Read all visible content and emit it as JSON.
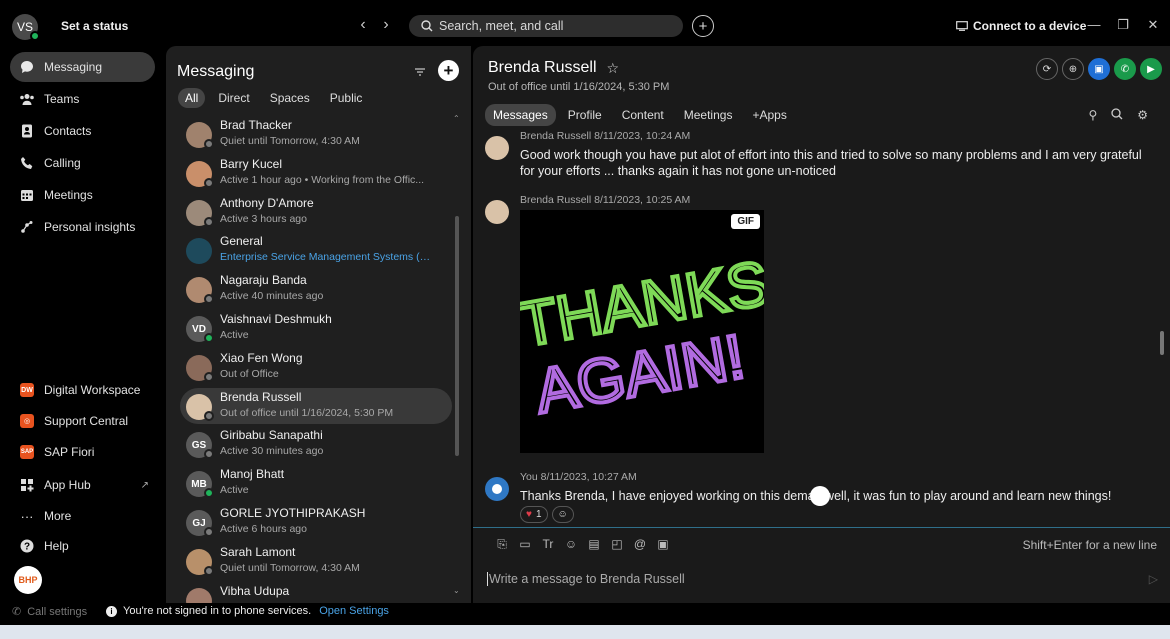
{
  "topbar": {
    "avatar_initials": "VS",
    "set_status": "Set a status",
    "back": "‹",
    "forward": "›",
    "search_placeholder": "Search, meet, and call",
    "connect_device": "Connect to a device",
    "minimize": "—",
    "restore": "❐",
    "close": "✕"
  },
  "nav": {
    "items": [
      {
        "label": "Messaging",
        "icon": "chat-icon"
      },
      {
        "label": "Teams",
        "icon": "teams-icon"
      },
      {
        "label": "Contacts",
        "icon": "contacts-icon"
      },
      {
        "label": "Calling",
        "icon": "phone-icon"
      },
      {
        "label": "Meetings",
        "icon": "calendar-icon"
      },
      {
        "label": "Personal insights",
        "icon": "insights-icon"
      }
    ],
    "apps": [
      {
        "label": "Digital Workspace",
        "badge": "DW",
        "color": "#e8531f"
      },
      {
        "label": "Support Central",
        "badge": "SC",
        "color": "#e8531f"
      },
      {
        "label": "SAP Fiori",
        "badge": "SAP",
        "color": "#e8531f"
      },
      {
        "label": "App Hub",
        "badge": "",
        "color": "#cccccc"
      },
      {
        "label": "More",
        "badge": "",
        "color": "#cccccc"
      },
      {
        "label": "Help",
        "badge": "",
        "color": "#cccccc"
      }
    ],
    "bhp_logo": "BHP"
  },
  "messaging": {
    "title": "Messaging",
    "tabs": [
      "All",
      "Direct",
      "Spaces",
      "Public"
    ],
    "contacts": [
      {
        "name": "Brad Thacker",
        "status": "Quiet until Tomorrow, 4:30 AM",
        "initials": "",
        "avatar_color": "#a0826d",
        "presence": "#7a7a7a",
        "link": false
      },
      {
        "name": "Barry Kucel",
        "status": "Active 1 hour ago • Working from the Offic...",
        "initials": "",
        "avatar_color": "#c98f6a",
        "presence": "#7a7a7a",
        "link": false
      },
      {
        "name": "Anthony D'Amore",
        "status": "Active 3 hours ago",
        "initials": "",
        "avatar_color": "#9c8a7a",
        "presence": "#7a7a7a",
        "link": false
      },
      {
        "name": "General",
        "status": "Enterprise Service Management Systems (E...",
        "initials": "",
        "avatar_color": "#1e4a5c",
        "presence": "",
        "link": true
      },
      {
        "name": "Nagaraju Banda",
        "status": "Active 40 minutes ago",
        "initials": "",
        "avatar_color": "#b08a70",
        "presence": "#7a7a7a",
        "link": false
      },
      {
        "name": "Vaishnavi Deshmukh",
        "status": "Active",
        "initials": "VD",
        "avatar_color": "#5a5a5a",
        "presence": "#1fb35a",
        "link": false
      },
      {
        "name": "Xiao Fen Wong",
        "status": "Out of Office",
        "initials": "",
        "avatar_color": "#8a6a5a",
        "presence": "#7a7a7a",
        "link": false
      },
      {
        "name": "Brenda Russell",
        "status": "Out of office until 1/16/2024, 5:30 PM",
        "initials": "",
        "avatar_color": "#d9c2a8",
        "presence": "#7a7a7a",
        "link": false
      },
      {
        "name": "Giribabu Sanapathi",
        "status": "Active 30 minutes ago",
        "initials": "GS",
        "avatar_color": "#5a5a5a",
        "presence": "#7a7a7a",
        "link": false
      },
      {
        "name": "Manoj Bhatt",
        "status": "Active",
        "initials": "MB",
        "avatar_color": "#5a5a5a",
        "presence": "#1fb35a",
        "link": false
      },
      {
        "name": "GORLE JYOTHIPRAKASH",
        "status": "Active 6 hours ago",
        "initials": "GJ",
        "avatar_color": "#5a5a5a",
        "presence": "#7a7a7a",
        "link": false
      },
      {
        "name": "Sarah Lamont",
        "status": "Quiet until Tomorrow, 4:30 AM",
        "initials": "",
        "avatar_color": "#b8906a",
        "presence": "#7a7a7a",
        "link": false
      },
      {
        "name": "Vibha Udupa",
        "status": "",
        "initials": "",
        "avatar_color": "#a07a6a",
        "presence": "",
        "link": false
      }
    ],
    "selected_index": 7
  },
  "conversation": {
    "name": "Brenda Russell",
    "subtitle": "Out of office until 1/16/2024, 5:30 PM",
    "tabs": [
      "Messages",
      "Profile",
      "Content",
      "Meetings",
      "+Apps"
    ],
    "messages": [
      {
        "meta": "Brenda Russell  8/11/2023, 10:24 AM",
        "text": "Good work though you have put alot of effort into this and tried to solve so many problems and I am very grateful for your efforts ... thanks again it has not gone un-noticed"
      },
      {
        "meta": "Brenda Russell  8/11/2023, 10:25 AM",
        "text": ""
      },
      {
        "meta": "You  8/11/2023, 10:27 AM",
        "text": "Thanks Brenda, I have enjoyed working on this deman  well, it was fun to play around and learn new things!"
      }
    ],
    "gif_badge": "GIF",
    "gif_line1": "THANKS",
    "gif_line2": "AGAIN!",
    "reaction_count": "1",
    "shift_hint": "Shift+Enter for a new line",
    "compose_placeholder": "Write a message to Brenda Russell"
  },
  "status_bar": {
    "call_settings": "Call settings",
    "phone_message": "You're not signed in to phone services.",
    "open_settings": "Open Settings"
  }
}
